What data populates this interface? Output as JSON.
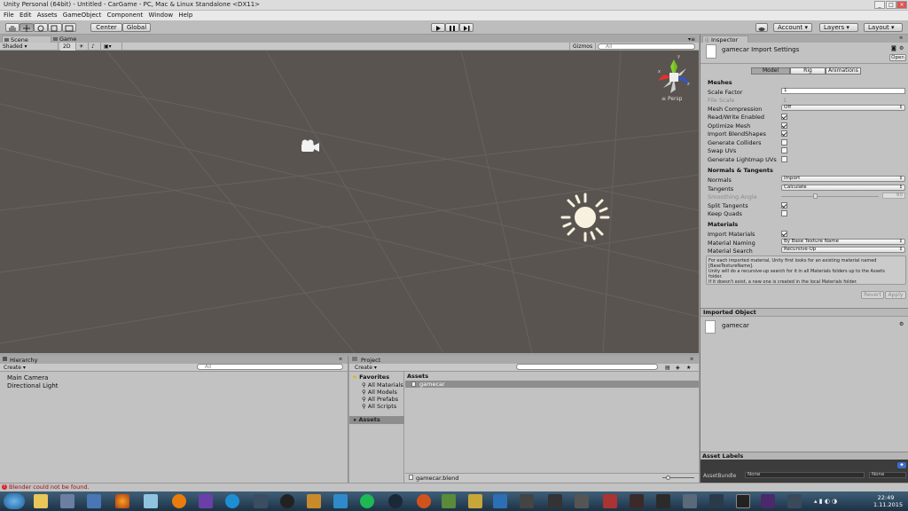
{
  "window": {
    "title": "Unity Personal (64bit) - Untitled - CarGame - PC, Mac & Linux Standalone <DX11>"
  },
  "menu": [
    "File",
    "Edit",
    "Assets",
    "GameObject",
    "Component",
    "Window",
    "Help"
  ],
  "toolbar": {
    "pivot": "Center",
    "space": "Global",
    "account": "Account",
    "layers": "Layers",
    "layout": "Layout"
  },
  "scene": {
    "tab_scene": "Scene",
    "tab_game": "Game",
    "shading": "Shaded",
    "mode_2d": "2D",
    "gizmos": "Gizmos",
    "search_placeholder": "All",
    "persp_label": "Persp",
    "axis_x": "x",
    "axis_z": "z",
    "axis_y": "y"
  },
  "hierarchy": {
    "title": "Hierarchy",
    "create": "Create",
    "search_placeholder": "All",
    "items": [
      "Main Camera",
      "Directional Light"
    ]
  },
  "project": {
    "title": "Project",
    "create": "Create",
    "favorites_label": "Favorites",
    "favorites": [
      "All Materials",
      "All Models",
      "All Prefabs",
      "All Scripts"
    ],
    "assets_label": "Assets",
    "assets_header": "Assets",
    "asset_items": [
      "gamecar"
    ],
    "selected_file": "gamecar.blend"
  },
  "inspector": {
    "title": "Inspector",
    "header": "gamecar Import Settings",
    "open": "Open",
    "tabs": [
      "Model",
      "Rig",
      "Animations"
    ],
    "meshes": "Meshes",
    "scale_factor_label": "Scale Factor",
    "scale_factor": "1",
    "file_scale_label": "File Scale",
    "file_scale": "1",
    "mesh_compression_label": "Mesh Compression",
    "mesh_compression": "Off",
    "read_write_label": "Read/Write Enabled",
    "optimize_mesh_label": "Optimize Mesh",
    "import_blendshapes_label": "Import BlendShapes",
    "generate_colliders_label": "Generate Colliders",
    "swap_uvs_label": "Swap UVs",
    "lightmap_uvs_label": "Generate Lightmap UVs",
    "normals_tangents": "Normals & Tangents",
    "normals_label": "Normals",
    "normals": "Import",
    "tangents_label": "Tangents",
    "tangents": "Calculate",
    "smoothing_label": "Smoothing Angle",
    "smoothing": "60",
    "split_tangents_label": "Split Tangents",
    "keep_quads_label": "Keep Quads",
    "materials": "Materials",
    "import_materials_label": "Import Materials",
    "material_naming_label": "Material Naming",
    "material_naming": "By Base Texture Name",
    "material_search_label": "Material Search",
    "material_search": "Recursive-Up",
    "help_lines": [
      "For each imported material, Unity first looks for an existing material named",
      "[BaseTextureName].",
      "Unity will do a recursive-up search for it in all Materials folders up to the Assets",
      "folder.",
      "If it doesn't exist, a new one is created in the local Materials folder."
    ],
    "revert": "Revert",
    "apply": "Apply",
    "imported_object_header": "Imported Object",
    "imported_object": "gamecar",
    "asset_labels": "Asset Labels",
    "asset_bundle_label": "AssetBundle",
    "asset_bundle": "None",
    "asset_bundle_variant": "None"
  },
  "status": {
    "message": "Blender could not be found."
  },
  "clock": {
    "time": "22:49",
    "date": "1.11.2015"
  }
}
